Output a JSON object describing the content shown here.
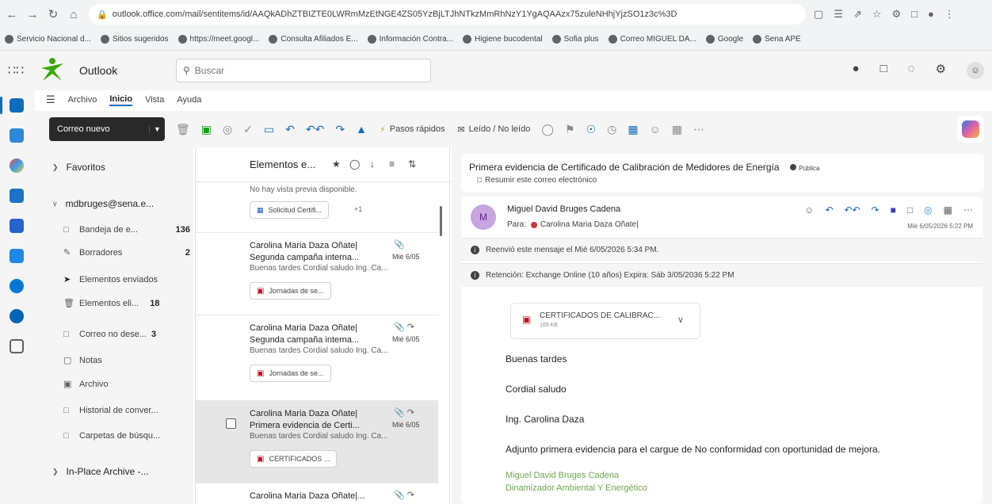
{
  "browser": {
    "url": "outlook.office.com/mail/sentitems/id/AAQkADhZTBIZTE0LWRmMzEtNGE4ZS05YzBjLTJhNTkzMmRhNzY1YgAQAAzx75zuleNHhjYjzSO1z3c%3D",
    "bookmarks": [
      "Servicio Nacional d...",
      "Sitios sugeridos",
      "https://meet.googl...",
      "Consulta Afiliados E...",
      "Información Contra...",
      "Higiene bucodental",
      "Sofia plus",
      "Correo MIGUEL DA...",
      "Google",
      "Sena APE"
    ]
  },
  "header": {
    "app_name": "Outlook",
    "search_placeholder": "Buscar"
  },
  "menu": {
    "tabs": [
      "Archivo",
      "Inicio",
      "Vista",
      "Ayuda"
    ]
  },
  "ribbon": {
    "new_mail": "Correo nuevo",
    "quick_steps": "Pasos rápidos",
    "read_unread": "Leído / No leído"
  },
  "folders": {
    "favorites": "Favoritos",
    "account": "mdbruges@sena.e...",
    "items": [
      {
        "label": "Bandeja de e...",
        "count": "136"
      },
      {
        "label": "Borradores",
        "count": "2"
      },
      {
        "label": "Elementos enviados",
        "count": ""
      },
      {
        "label": "Elementos eli...",
        "count": "18"
      },
      {
        "label": "Correo no dese...",
        "count": "3"
      },
      {
        "label": "Notas",
        "count": ""
      },
      {
        "label": "Archivo",
        "count": ""
      },
      {
        "label": "Historial de conver...",
        "count": ""
      },
      {
        "label": "Carpetas de búsqu...",
        "count": ""
      }
    ],
    "archive": "In-Place Archive -..."
  },
  "list": {
    "title": "Elementos e...",
    "top_preview": "No hay vista previa disponible.",
    "top_attachment": "Solicitud Certifi...",
    "top_more": "+1",
    "messages": [
      {
        "from": "Carolina Maria Daza Oñate|",
        "subject": "Segunda campaña interna...",
        "date": "Mié 6/05",
        "preview": "Buenas tardes Cordial saludo Ing. Ca...",
        "attachment": "Jornadas de se..."
      },
      {
        "from": "Carolina Maria Daza Oñate|",
        "subject": "Segunda campaña interna...",
        "date": "Mié 6/05",
        "preview": "Buenas tardes Cordial saludo Ing. Ca...",
        "attachment": "Jornadas de se..."
      },
      {
        "from": "Carolina Maria Daza Oñate|",
        "subject": "Primera evidencia de Certi...",
        "date": "Mié 6/05",
        "preview": "Buenas tardes Cordial saludo Ing. Ca...",
        "attachment": "CERTIFICADOS ..."
      },
      {
        "from": "Carolina Maria Daza Oñate|..."
      }
    ]
  },
  "reading": {
    "subject": "Primera evidencia de Certificado de Calibración de Medidores de Energía",
    "label": "Pública",
    "summarize": "Resumir este correo electrónico",
    "avatar": "M",
    "sender": "Miguel David Bruges Cadena",
    "to_prefix": "Para:",
    "to": "Carolina Maria Daza Oñate|",
    "date": "Mié 6/05/2026 5:22 PM",
    "notice1": "Reenvió este mensaje el Mié 6/05/2026 5:34 PM.",
    "notice2": "Retención: Exchange Online (10 años) Expira: Sáb 3/05/2036 5:22 PM",
    "file_name": "CERTIFICADOS DE CALIBRAC...",
    "file_size": "165 KB",
    "body": [
      "Buenas tardes",
      "Cordial saludo",
      "Ing. Carolina Daza",
      "Adjunto primera evidencia para el cargue de No conformidad con oportunidad de mejora."
    ],
    "signature": [
      "Miguel David Bruges Cadena",
      "Dinamizador Ambiental Y Energético"
    ]
  },
  "colors": {
    "accent": "#0f6cbd",
    "signature": "#6aa84f",
    "attachment_pdf": "#c50f1f"
  }
}
